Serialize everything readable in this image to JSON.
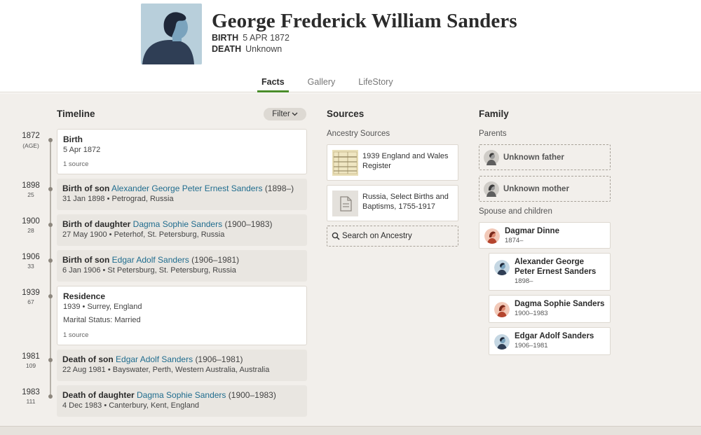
{
  "person": {
    "name": "George Frederick William Sanders",
    "birth_label": "BIRTH",
    "birth_value": "5 APR 1872",
    "death_label": "DEATH",
    "death_value": "Unknown"
  },
  "tabs": [
    "Facts",
    "Gallery",
    "LifeStory"
  ],
  "active_tab": "Facts",
  "timeline": {
    "title": "Timeline",
    "filter_label": "Filter",
    "events": [
      {
        "year": "1872",
        "age": "(AGE)",
        "title": "Birth",
        "date": "5 Apr 1872",
        "source": "1 source"
      },
      {
        "year": "1898",
        "age": "25",
        "title": "Birth of son",
        "link": "Alexander George Peter Ernest Sanders",
        "years": "(1898–)",
        "date": "31 Jan 1898",
        "place": "Petrograd, Russia"
      },
      {
        "year": "1900",
        "age": "28",
        "title": "Birth of daughter",
        "link": "Dagma Sophie Sanders",
        "years": "(1900–1983)",
        "date": "27 May 1900",
        "place": "Peterhof, St. Petersburg, Russia"
      },
      {
        "year": "1906",
        "age": "33",
        "title": "Birth of son",
        "link": "Edgar Adolf Sanders",
        "years": "(1906–1981)",
        "date": "6 Jan 1906",
        "place": "St Petersburg, St. Petersburg, Russia"
      },
      {
        "year": "1939",
        "age": "67",
        "title": "Residence",
        "date": "1939",
        "place": "Surrey, England",
        "note": "Marital Status: Married",
        "source": "1 source"
      },
      {
        "year": "1981",
        "age": "109",
        "title": "Death of son",
        "link": "Edgar Adolf Sanders",
        "years": "(1906–1981)",
        "date": "22 Aug 1981",
        "place": "Bayswater, Perth, Western Australia, Australia"
      },
      {
        "year": "1983",
        "age": "111",
        "title": "Death of daughter",
        "link": "Dagma Sophie Sanders",
        "years": "(1900–1983)",
        "date": "4 Dec 1983",
        "place": "Canterbury, Kent, England"
      }
    ]
  },
  "sources": {
    "title": "Sources",
    "subtitle": "Ancestry Sources",
    "items": [
      "1939 England and Wales Register",
      "Russia, Select Births and Baptisms, 1755-1917"
    ],
    "search_label": "Search on Ancestry"
  },
  "family": {
    "title": "Family",
    "parents_label": "Parents",
    "father": "Unknown father",
    "mother": "Unknown mother",
    "spouse_label": "Spouse and children",
    "spouse": {
      "name": "Dagmar Dinne",
      "dates": "1874–"
    },
    "children": [
      {
        "name": "Alexander George Peter Ernest Sanders",
        "dates": "1898–"
      },
      {
        "name": "Dagma Sophie Sanders",
        "dates": "1900–1983"
      },
      {
        "name": "Edgar Adolf Sanders",
        "dates": "1906–1981"
      }
    ]
  },
  "colors": {
    "link": "#1f6c8e",
    "tab_active_underline": "#4a8c2a",
    "background": "#f2efeb"
  },
  "icons": [
    "person-silhouette-icon",
    "chevron-down-icon",
    "document-icon",
    "search-icon",
    "male-avatar-icon",
    "female-avatar-icon"
  ]
}
